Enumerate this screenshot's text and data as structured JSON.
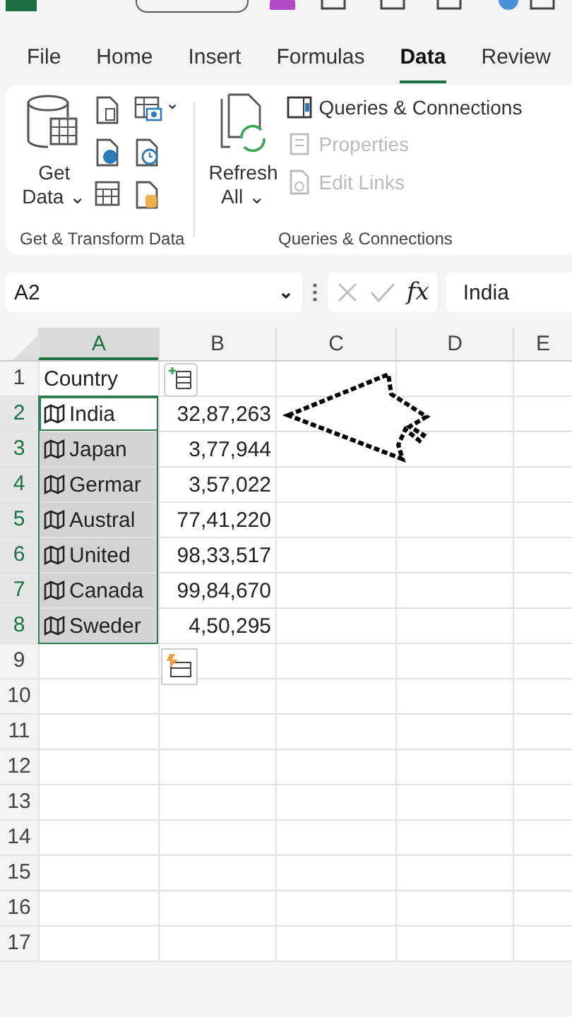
{
  "menu_tabs": [
    {
      "label": "File",
      "selected": false
    },
    {
      "label": "Home",
      "selected": false
    },
    {
      "label": "Insert",
      "selected": false
    },
    {
      "label": "Formulas",
      "selected": false
    },
    {
      "label": "Data",
      "selected": true
    },
    {
      "label": "Review",
      "selected": false
    }
  ],
  "ribbon": {
    "groups": [
      {
        "title": "Get & Transform Data",
        "big_button": {
          "label_line1": "Get",
          "label_line2": "Data",
          "caret": "⌄"
        },
        "small_caret": "⌄"
      },
      {
        "title": "Queries & Connections",
        "big_button": {
          "label_line1": "Refresh",
          "label_line2": "All",
          "caret": "⌄"
        },
        "items": [
          {
            "label": "Queries & Connections",
            "disabled": false
          },
          {
            "label": "Properties",
            "disabled": true
          },
          {
            "label": "Edit Links",
            "disabled": true
          }
        ]
      }
    ]
  },
  "formula_bar": {
    "name_box": "A2",
    "name_box_caret": "⌄",
    "fx": "fx",
    "value": "India"
  },
  "columns": [
    {
      "label": "A",
      "selected": true
    },
    {
      "label": "B",
      "selected": false
    },
    {
      "label": "C",
      "selected": false
    },
    {
      "label": "D",
      "selected": false
    },
    {
      "label": "E",
      "selected": false
    }
  ],
  "rows": [
    {
      "number": "1",
      "country": "Country",
      "value": "",
      "geo": false,
      "selected": false,
      "active": false
    },
    {
      "number": "2",
      "country": "India",
      "value": "32,87,263",
      "geo": true,
      "selected": true,
      "active": true
    },
    {
      "number": "3",
      "country": "Japan",
      "value": "3,77,944",
      "geo": true,
      "selected": true,
      "active": false
    },
    {
      "number": "4",
      "country": "Germar",
      "value": "3,57,022",
      "geo": true,
      "selected": true,
      "active": false
    },
    {
      "number": "5",
      "country": "Austral",
      "value": "77,41,220",
      "geo": true,
      "selected": true,
      "active": false
    },
    {
      "number": "6",
      "country": "United",
      "value": "98,33,517",
      "geo": true,
      "selected": true,
      "active": false
    },
    {
      "number": "7",
      "country": "Canada",
      "value": "99,84,670",
      "geo": true,
      "selected": true,
      "active": false
    },
    {
      "number": "8",
      "country": "Sweder",
      "value": "4,50,295",
      "geo": true,
      "selected": true,
      "active": false
    },
    {
      "number": "9",
      "country": "",
      "value": "",
      "geo": false,
      "selected": false,
      "active": false
    },
    {
      "number": "10",
      "country": "",
      "value": "",
      "geo": false,
      "selected": false,
      "active": false
    },
    {
      "number": "11",
      "country": "",
      "value": "",
      "geo": false,
      "selected": false,
      "active": false
    },
    {
      "number": "12",
      "country": "",
      "value": "",
      "geo": false,
      "selected": false,
      "active": false
    },
    {
      "number": "13",
      "country": "",
      "value": "",
      "geo": false,
      "selected": false,
      "active": false
    },
    {
      "number": "14",
      "country": "",
      "value": "",
      "geo": false,
      "selected": false,
      "active": false
    },
    {
      "number": "15",
      "country": "",
      "value": "",
      "geo": false,
      "selected": false,
      "active": false
    },
    {
      "number": "16",
      "country": "",
      "value": "",
      "geo": false,
      "selected": false,
      "active": false
    },
    {
      "number": "17",
      "country": "",
      "value": "",
      "geo": false,
      "selected": false,
      "active": false
    }
  ]
}
